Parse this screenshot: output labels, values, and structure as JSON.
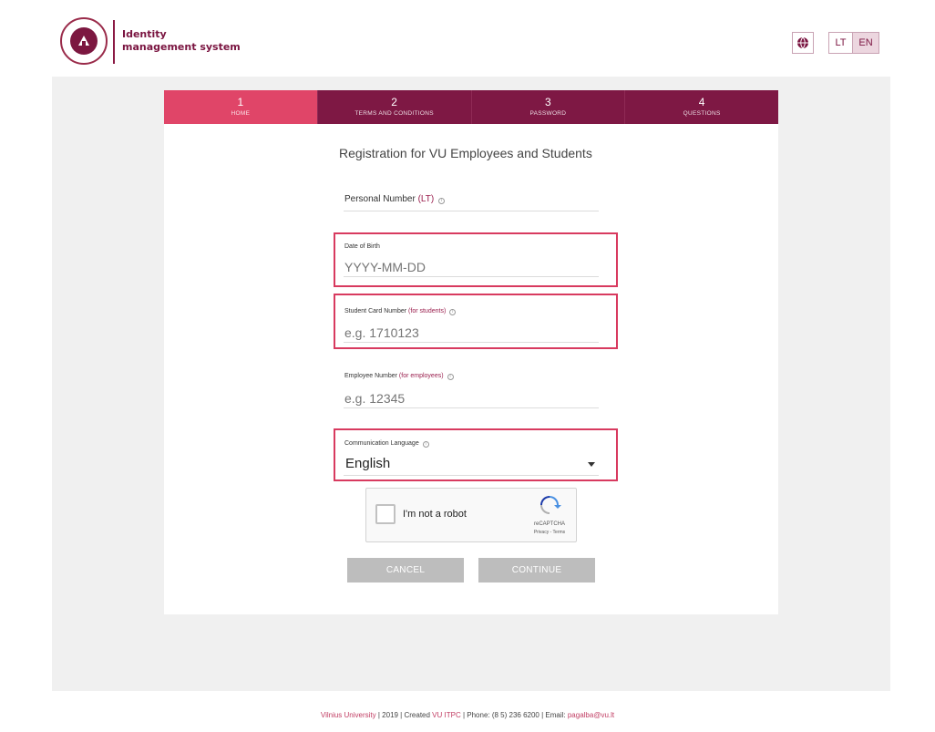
{
  "header": {
    "logo_line1": "Identity",
    "logo_line2": "management system",
    "lang_lt": "LT",
    "lang_en": "EN"
  },
  "steps": [
    {
      "num": "1",
      "label": "HOME",
      "active": true
    },
    {
      "num": "2",
      "label": "TERMS AND CONDITIONS",
      "active": false
    },
    {
      "num": "3",
      "label": "PASSWORD",
      "active": false
    },
    {
      "num": "4",
      "label": "QUESTIONS",
      "active": false
    }
  ],
  "form": {
    "title": "Registration for VU Employees and Students",
    "personal_number": {
      "label": "Personal Number",
      "hint": "(LT)"
    },
    "date_of_birth": {
      "label": "Date of Birth",
      "placeholder": "YYYY-MM-DD"
    },
    "student_card": {
      "label": "Student Card Number",
      "hint": "(for students)",
      "placeholder": "e.g. 1710123"
    },
    "employee_number": {
      "label": "Employee Number",
      "hint": "(for employees)",
      "placeholder": "e.g. 12345"
    },
    "communication_language": {
      "label": "Communication Language",
      "value": "English"
    }
  },
  "captcha": {
    "label": "I'm not a robot",
    "brand": "reCAPTCHA",
    "links": "Privacy - Terms"
  },
  "buttons": {
    "cancel": "CANCEL",
    "continue": "CONTINUE"
  },
  "footer": {
    "university": "Vilnius University",
    "sep1": " | 2019 | Created ",
    "itpc": "VU ITPC",
    "sep2": " | Phone: (8 5) 236 6200 | Email: ",
    "email": "pagalba@vu.lt"
  },
  "colors": {
    "brand": "#7e1844",
    "active_step": "#e04568",
    "highlight": "#d83a5f"
  }
}
